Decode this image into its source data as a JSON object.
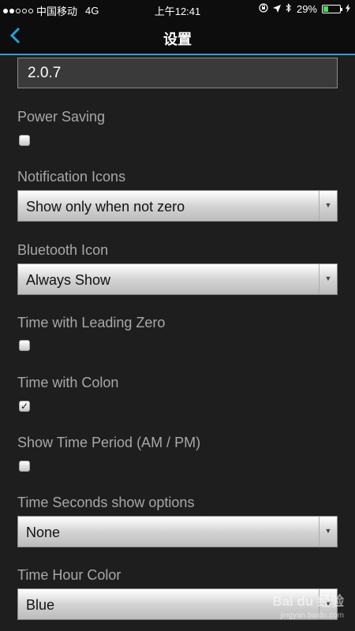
{
  "status_bar": {
    "carrier": "中国移动",
    "network": "4G",
    "time": "上午12:41",
    "battery": "29%",
    "battery_level": 0.29,
    "icons": [
      "signal-dots-icon",
      "lock-rotation-icon",
      "location-arrow-icon",
      "bluetooth-icon",
      "battery-icon",
      "charging-icon"
    ]
  },
  "nav": {
    "back_icon": "chevron-left-icon",
    "title": "设置"
  },
  "version_field": {
    "value": "2.0.7"
  },
  "settings": {
    "power_saving": {
      "label": "Power Saving",
      "checked": false
    },
    "notification_icons": {
      "label": "Notification Icons",
      "value": "Show only when not zero"
    },
    "bluetooth_icon": {
      "label": "Bluetooth Icon",
      "value": "Always Show"
    },
    "time_leading_zero": {
      "label": "Time with Leading Zero",
      "checked": false
    },
    "time_with_colon": {
      "label": "Time with Colon",
      "checked": true,
      "check_mark": "✓"
    },
    "show_time_period": {
      "label": "Show Time Period (AM / PM)",
      "checked": false
    },
    "time_seconds": {
      "label": "Time Seconds show options",
      "value": "None"
    },
    "time_hour_color": {
      "label": "Time Hour Color",
      "value": "Blue"
    }
  },
  "watermark": {
    "text": "Bai du 经验",
    "sub": "jingyan.baidu.com"
  },
  "colors": {
    "accent": "#2a9fd6",
    "background": "#1e1e1e",
    "battery_green": "#4cd964"
  }
}
